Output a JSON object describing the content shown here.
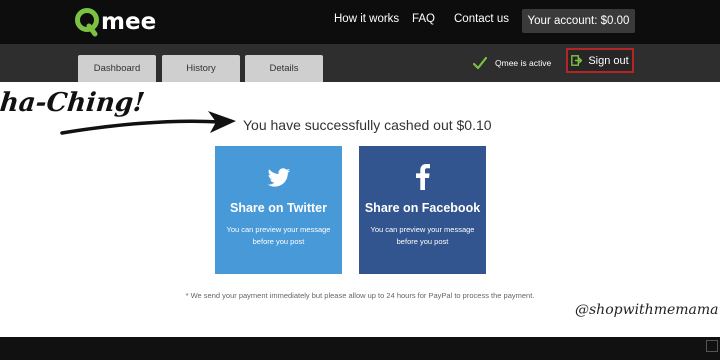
{
  "header": {
    "logo_text": "mee",
    "nav": [
      "How it works",
      "FAQ",
      "Contact us"
    ],
    "account_button": "Your account: $0.00"
  },
  "subnav": {
    "tabs": [
      "Dashboard",
      "History",
      "Details"
    ],
    "status": "Qmee is active",
    "signout": "Sign out"
  },
  "main": {
    "annotation": "ha-Ching!",
    "success_message": "You have successfully cashed out $0.10",
    "share": [
      {
        "title": "Share on Twitter",
        "subtitle": "You can preview your message before you post",
        "color": "#4899d8"
      },
      {
        "title": "Share on Facebook",
        "subtitle": "You can preview your message before you post",
        "color": "#33558f"
      }
    ],
    "footnote": "* We send your payment immediately but please allow up to 24 hours for PayPal to process the payment.",
    "watermark": "@shopwithmemama"
  },
  "colors": {
    "brand_green": "#7cc242",
    "topbar": "#0d0d0d",
    "subbar": "#2e2e2e",
    "signout_border": "#b32626"
  },
  "icons": {
    "logo": "qmee-q-logo",
    "status": "checkmark-icon",
    "signout": "signout-icon",
    "twitter": "twitter-bird-icon",
    "facebook": "facebook-f-icon"
  }
}
